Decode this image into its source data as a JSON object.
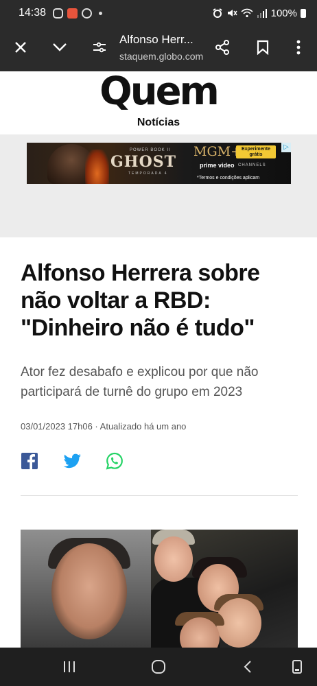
{
  "status_bar": {
    "time": "14:38",
    "battery": "100%",
    "icons": [
      "instagram-icon",
      "app-notification-icon",
      "youtube-icon",
      "alarm-icon",
      "mute-icon",
      "wifi-icon",
      "signal-icon",
      "battery-icon"
    ]
  },
  "browser": {
    "page_title": "Alfonso Herr...",
    "domain": "staquem.globo.com",
    "buttons": [
      "close",
      "collapse",
      "page-settings",
      "share",
      "bookmark",
      "more"
    ]
  },
  "site": {
    "logo": "Quem",
    "section": "Notícias"
  },
  "ad": {
    "ghost_pre": "POWER BOOK II",
    "ghost_title": "GHOST",
    "ghost_season": "TEMPORADA 4",
    "mgm": "MGM+",
    "cta": "Experimente grátis",
    "prime": "prime video",
    "channels": "CHANNELS",
    "terms": "*Termos e condições aplicam"
  },
  "article": {
    "headline": "Alfonso Herrera sobre não voltar a RBD: \"Dinheiro não é tudo\"",
    "subtitle": "Ator fez desabafo e explicou por que não participará de turnê do grupo em 2023",
    "meta": "03/01/2023 17h06 · Atualizado há um ano"
  },
  "share": {
    "facebook_color": "#3b5998",
    "twitter_color": "#1da1f2",
    "whatsapp_color": "#25d366"
  },
  "navbar": {
    "buttons": [
      "recent-apps",
      "home",
      "back",
      "screen-rotate"
    ]
  }
}
